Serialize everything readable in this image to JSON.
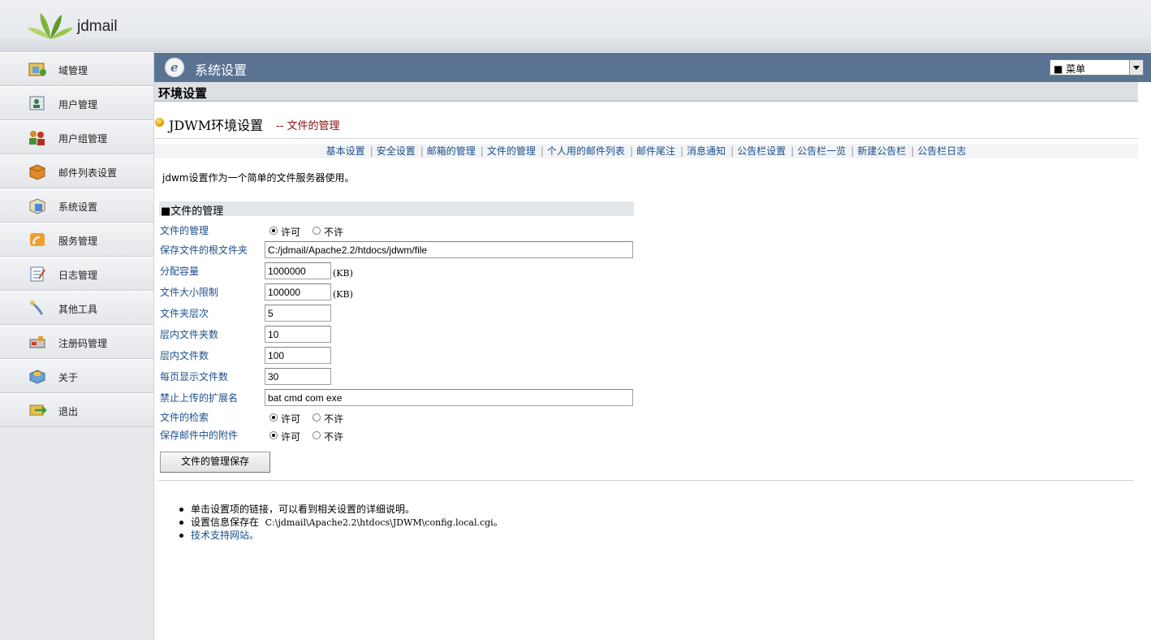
{
  "brand": {
    "name": "jdmail"
  },
  "sidebar": {
    "items": [
      {
        "label": "域管理",
        "icon": "domain-icon"
      },
      {
        "label": "用户管理",
        "icon": "user-icon"
      },
      {
        "label": "用户组管理",
        "icon": "user-group-icon"
      },
      {
        "label": "邮件列表设置",
        "icon": "mail-list-icon"
      },
      {
        "label": "系统设置",
        "icon": "system-settings-icon"
      },
      {
        "label": "服务管理",
        "icon": "service-icon"
      },
      {
        "label": "日志管理",
        "icon": "log-icon"
      },
      {
        "label": "其他工具",
        "icon": "tools-icon"
      },
      {
        "label": "注册码管理",
        "icon": "license-icon"
      },
      {
        "label": "关于",
        "icon": "about-icon"
      },
      {
        "label": "退出",
        "icon": "logout-icon"
      }
    ]
  },
  "header": {
    "title": "系统设置",
    "menu_select": "■ 菜单"
  },
  "band": {
    "title": "环境设置"
  },
  "page": {
    "title": "JDWM环境设置",
    "subtitle": "-- 文件的管理"
  },
  "nav": {
    "links": [
      "基本设置",
      "安全设置",
      "邮箱的管理",
      "文件的管理",
      "个人用的邮件列表",
      "邮件尾注",
      "消息通知",
      "公告栏设置",
      "公告栏一览",
      "新建公告栏",
      "公告栏日志"
    ]
  },
  "description": "jdwm设置作为一个简单的文件服务器使用。",
  "form": {
    "section_title": "■文件的管理",
    "allow_label": "许可",
    "deny_label": "不许",
    "file_management": {
      "label": "文件的管理",
      "value": "许可"
    },
    "root_folder": {
      "label": "保存文件的根文件夹",
      "value": "C:/jdmail/Apache2.2/htdocs/jdwm/file"
    },
    "quota": {
      "label": "分配容量",
      "value": "1000000",
      "unit": "(KB)"
    },
    "max_size": {
      "label": "文件大小限制",
      "value": "100000",
      "unit": "(KB)"
    },
    "folder_depth": {
      "label": "文件夹层次",
      "value": "5"
    },
    "folders_per_level": {
      "label": "层内文件夹数",
      "value": "10"
    },
    "files_per_level": {
      "label": "层内文件数",
      "value": "100"
    },
    "files_per_page": {
      "label": "每页显示文件数",
      "value": "30"
    },
    "blocked_ext": {
      "label": "禁止上传的扩展名",
      "value": "bat cmd com exe"
    },
    "file_search": {
      "label": "文件的检索",
      "value": "许可"
    },
    "save_attachments": {
      "label": "保存邮件中的附件",
      "value": "许可"
    },
    "save_button": "文件的管理保存"
  },
  "notes": {
    "n1": "单击设置项的链接，可以看到相关设置的详细说明。",
    "n2_prefix": "设置信息保存在",
    "n2_path": "C:\\jdmail\\Apache2.2\\htdocs\\JDWM\\config.local.cgi",
    "n2_suffix": "。",
    "n3": "技术支持网站。"
  }
}
